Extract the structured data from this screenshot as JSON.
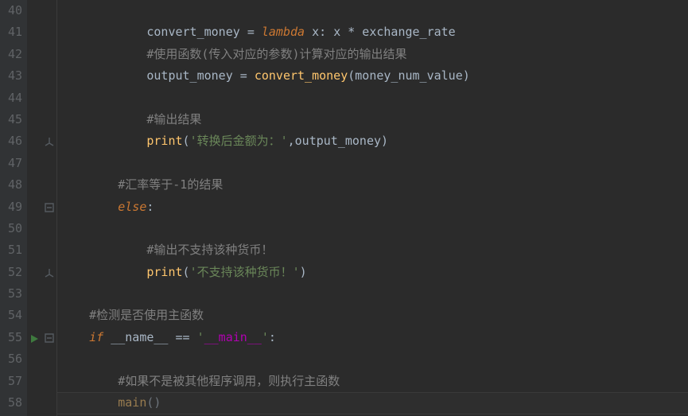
{
  "editor": {
    "first_line_number": 40,
    "caret_on_line": 58,
    "run_marker_line": 55,
    "colors": {
      "background": "#2b2b2b",
      "gutter": "#313335",
      "line_number": "#606366",
      "default_text": "#a9b7c6",
      "keyword": "#cc7832",
      "call": "#ffc66d",
      "comment": "#808080",
      "string": "#6a8759",
      "dunder": "#b200b2"
    }
  },
  "fold_markers": [
    {
      "line": 46,
      "type": "end"
    },
    {
      "line": 49,
      "type": "start"
    },
    {
      "line": 52,
      "type": "end"
    },
    {
      "line": 55,
      "type": "start"
    }
  ],
  "lines": [
    {
      "num": 40,
      "indent": 0,
      "tokens": []
    },
    {
      "num": 41,
      "indent": 12,
      "tokens": [
        {
          "t": "convert_money ",
          "c": "tok-default"
        },
        {
          "t": "= ",
          "c": "tok-op"
        },
        {
          "t": "lambda ",
          "c": "tok-kw-it"
        },
        {
          "t": "x",
          "c": "tok-param"
        },
        {
          "t": ": ",
          "c": "tok-op"
        },
        {
          "t": "x * exchange_rate",
          "c": "tok-default"
        }
      ]
    },
    {
      "num": 42,
      "indent": 12,
      "tokens": [
        {
          "t": "#使用函数(传入对应的参数)计算对应的输出结果",
          "c": "tok-comment"
        }
      ]
    },
    {
      "num": 43,
      "indent": 12,
      "tokens": [
        {
          "t": "output_money ",
          "c": "tok-default"
        },
        {
          "t": "= ",
          "c": "tok-op"
        },
        {
          "t": "convert_money",
          "c": "tok-call"
        },
        {
          "t": "(money_num_value)",
          "c": "tok-default"
        }
      ]
    },
    {
      "num": 44,
      "indent": 0,
      "tokens": []
    },
    {
      "num": 45,
      "indent": 12,
      "tokens": [
        {
          "t": "#输出结果",
          "c": "tok-comment"
        }
      ]
    },
    {
      "num": 46,
      "indent": 12,
      "tokens": [
        {
          "t": "print",
          "c": "tok-call"
        },
        {
          "t": "(",
          "c": "tok-default"
        },
        {
          "t": "'转换后金额为：'",
          "c": "tok-str"
        },
        {
          "t": ",",
          "c": "tok-op"
        },
        {
          "t": "output_money)",
          "c": "tok-default"
        }
      ]
    },
    {
      "num": 47,
      "indent": 0,
      "tokens": []
    },
    {
      "num": 48,
      "indent": 8,
      "tokens": [
        {
          "t": "#汇率等于-1的结果",
          "c": "tok-comment"
        }
      ]
    },
    {
      "num": 49,
      "indent": 8,
      "tokens": [
        {
          "t": "else",
          "c": "tok-kw-it"
        },
        {
          "t": ":",
          "c": "tok-op"
        }
      ]
    },
    {
      "num": 50,
      "indent": 0,
      "tokens": []
    },
    {
      "num": 51,
      "indent": 12,
      "tokens": [
        {
          "t": "#输出不支持该种货币！",
          "c": "tok-comment"
        }
      ]
    },
    {
      "num": 52,
      "indent": 12,
      "tokens": [
        {
          "t": "print",
          "c": "tok-call"
        },
        {
          "t": "(",
          "c": "tok-default"
        },
        {
          "t": "'不支持该种货币！'",
          "c": "tok-str"
        },
        {
          "t": ")",
          "c": "tok-default"
        }
      ]
    },
    {
      "num": 53,
      "indent": 0,
      "tokens": []
    },
    {
      "num": 54,
      "indent": 4,
      "tokens": [
        {
          "t": "#检测是否使用主函数",
          "c": "tok-comment"
        }
      ]
    },
    {
      "num": 55,
      "indent": 4,
      "tokens": [
        {
          "t": "if ",
          "c": "tok-kw-it"
        },
        {
          "t": "__name__ ",
          "c": "tok-default"
        },
        {
          "t": "== ",
          "c": "tok-op"
        },
        {
          "t": "'",
          "c": "tok-str"
        },
        {
          "t": "__main__",
          "c": "tok-dunder"
        },
        {
          "t": "'",
          "c": "tok-str"
        },
        {
          "t": ":",
          "c": "tok-op"
        }
      ]
    },
    {
      "num": 56,
      "indent": 0,
      "tokens": []
    },
    {
      "num": 57,
      "indent": 8,
      "tokens": [
        {
          "t": "#如果不是被其他程序调用，则执行主函数",
          "c": "tok-comment"
        }
      ]
    },
    {
      "num": 58,
      "indent": 8,
      "tokens": [
        {
          "t": "main",
          "c": "tok-call"
        },
        {
          "t": "()",
          "c": "tok-default"
        }
      ]
    }
  ]
}
